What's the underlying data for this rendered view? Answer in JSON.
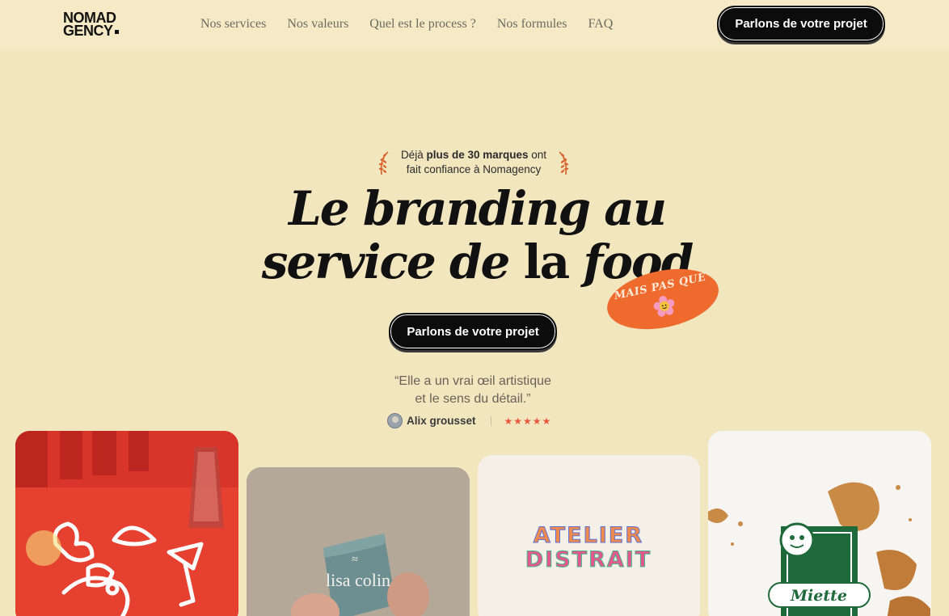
{
  "header": {
    "logo_line1": "NOMAD",
    "logo_line2": "GENCY",
    "nav": [
      "Nos services",
      "Nos valeurs",
      "Quel est le process ?",
      "Nos formules",
      "FAQ"
    ],
    "cta": "Parlons de votre projet"
  },
  "hero": {
    "trust_pre": "Déjà ",
    "trust_bold": "plus de 30 marques",
    "trust_mid": " ont",
    "trust_line2": "fait confiance à Nomagency",
    "title_le": "Le ",
    "title_branding": "branding",
    "title_au": " au",
    "title_service": "service de ",
    "title_la": "la ",
    "title_food": "food",
    "sticker": "MAIS PAS QUE",
    "cta": "Parlons de votre projet",
    "quote_line1": "“Elle a un vrai œil artistique",
    "quote_line2": "et le sens du détail.”",
    "reviewer": "Alix grousset",
    "stars": "★★★★★",
    "rating": 5
  },
  "cards": {
    "card2_brand": "lisa colin",
    "card3_line1": "ATELIER",
    "card3_line2": "DISTRAIT",
    "card4_brand": "Miette"
  },
  "colors": {
    "background": "#f2e6bf",
    "accent": "#ee6a2d",
    "button": "#0c0c0c",
    "star": "#e8573c"
  }
}
